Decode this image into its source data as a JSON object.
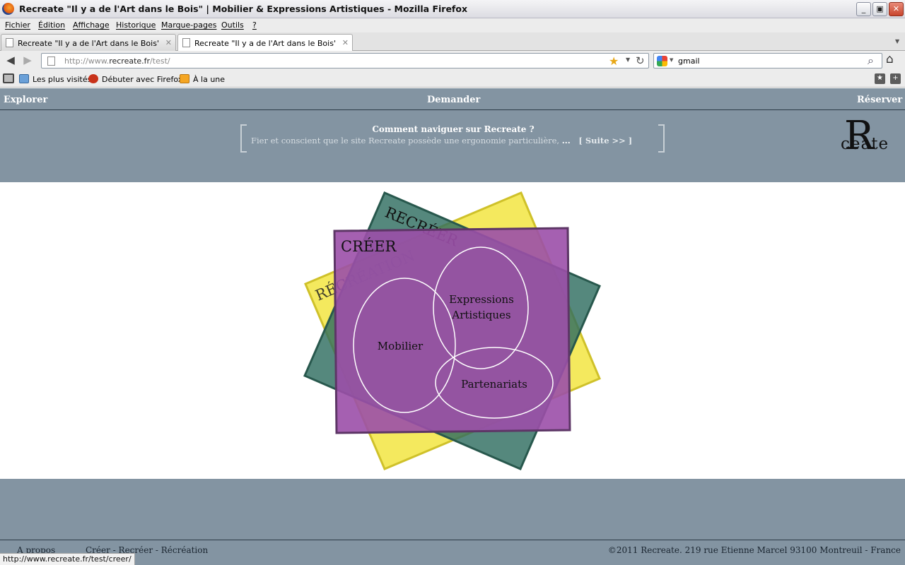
{
  "window": {
    "title": "Recreate \"Il y a de l'Art dans le Bois\" | Mobilier & Expressions Artistiques - Mozilla Firefox"
  },
  "menu": [
    "Fichier",
    "Édition",
    "Affichage",
    "Historique",
    "Marque-pages",
    "Outils",
    "?"
  ],
  "tabs": [
    {
      "label": "Recreate \"Il y a de l'Art dans le Bois\" > Se..."
    },
    {
      "label": "Recreate \"Il y a de l'Art dans le Bois\" | M..."
    }
  ],
  "navbar": {
    "url_prefix": "http://www.",
    "url_domain": "recreate.fr",
    "url_path": "/test/",
    "search_value": "gmail"
  },
  "bookmarks": [
    "Les plus visités",
    "Débuter avec Firefox",
    "À la une"
  ],
  "site": {
    "nav": {
      "explore": "Explorer",
      "ask": "Demander",
      "book": "Réserver"
    },
    "howto": {
      "title": "Comment naviguer sur Recreate ?",
      "text": "Fier et conscient que le site Recreate possède une ergonomie particulière,",
      "ellipsis": "...",
      "more": "[ Suite >> ]"
    },
    "logo": {
      "letter": "R",
      "small": "ceate"
    }
  },
  "diagram": {
    "recreer": "RECRÉER",
    "recreation": "RÉCRÉATION",
    "creer": "CRÉER",
    "mobilier": "Mobilier",
    "expressions_1": "Expressions",
    "expressions_2": "Artistiques",
    "partenariats": "Partenariats",
    "colors": {
      "yellow": "#f2e542",
      "green": "#2f6e60",
      "purple": "#9b4fa8"
    }
  },
  "footer": {
    "about": "A propos",
    "links": "Créer - Recréer - Récréation",
    "copyright": "©2011 Recreate. 219 rue Etienne Marcel 93100 Montreuil - France"
  },
  "status": "http://www.recreate.fr/test/creer/"
}
